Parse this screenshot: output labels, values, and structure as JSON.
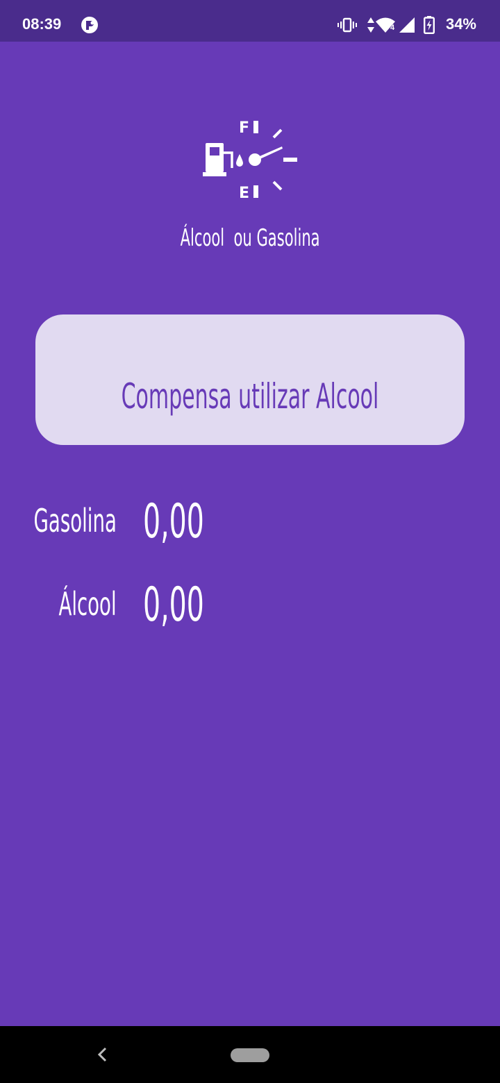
{
  "status_bar": {
    "time": "08:39",
    "app_icon": "app-notification-icon",
    "icons": [
      "vibrate-icon",
      "data-arrows-icon",
      "wifi-icon",
      "signal-icon",
      "battery-charging-icon"
    ],
    "network_label": "4",
    "battery": "34%"
  },
  "header": {
    "logo_icon": "fuel-gauge-icon",
    "gauge_full_label": "F",
    "gauge_empty_label": "E",
    "title": "Álcool  ou Gasolina"
  },
  "result": {
    "text": "Compensa utilizar Alcool"
  },
  "prices": [
    {
      "label": "Gasolina",
      "value": "0,00"
    },
    {
      "label": "Álcool",
      "value": "0,00"
    }
  ],
  "navigation": {
    "back_icon": "back-chevron-icon",
    "home_icon": "home-pill-icon"
  },
  "colors": {
    "background": "#673AB7",
    "status_bar": "#4A2C8C",
    "card": "#E1DAF1",
    "accent_text": "#673AB7",
    "text": "#FFFFFF",
    "nav_bar": "#000000"
  }
}
